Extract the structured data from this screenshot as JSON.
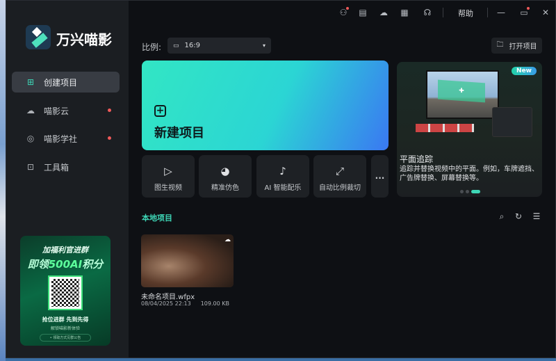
{
  "app": {
    "name": "万兴喵影"
  },
  "topbar": {
    "icons": [
      "account-icon",
      "tasks-icon",
      "cloud-sync-icon",
      "apps-grid-icon",
      "headset-support-icon"
    ],
    "help": "帮助"
  },
  "sidebar": {
    "items": [
      {
        "label": "创建项目",
        "icon": "new-file-icon",
        "active": true
      },
      {
        "label": "喵影云",
        "icon": "cloud-icon",
        "dot": true
      },
      {
        "label": "喵影学社",
        "icon": "bulb-icon",
        "dot": true
      },
      {
        "label": "工具箱",
        "icon": "toolbox-icon"
      }
    ]
  },
  "promo": {
    "line1": "加福利官进群",
    "line2a": "即领",
    "line2b": "500AI",
    "line2c": "积分",
    "line3": "抢位进群 先到先得",
    "line4": "解锁喵影新体验",
    "line5": "• 领取方式见群公告"
  },
  "ratio": {
    "label": "比例:",
    "value": "16:9"
  },
  "open_project": "打开项目",
  "new_project": "新建项目",
  "tools": [
    {
      "label": "图生视频",
      "icon": "image-to-video-icon"
    },
    {
      "label": "精准仿色",
      "icon": "palette-ai-icon"
    },
    {
      "label": "AI 智能配乐",
      "icon": "music-ai-icon"
    },
    {
      "label": "自动比例裁切",
      "icon": "auto-reframe-icon"
    }
  ],
  "more": "...",
  "feature": {
    "badge": "New",
    "title": "平面追踪",
    "desc": "追踪并替换视频中的平面。例如，车牌遮挡、广告牌替换、屏幕替换等。",
    "pages": 3,
    "current_page": 3
  },
  "local": {
    "title": "本地项目",
    "projects": [
      {
        "name": "未命名项目.wfpx",
        "date": "08/04/2025 22:13",
        "size": "109.00 KB"
      }
    ]
  },
  "colors": {
    "accent": "#3ed6b6",
    "sidebar": "#1b1e22",
    "bg": "#0e1014"
  }
}
